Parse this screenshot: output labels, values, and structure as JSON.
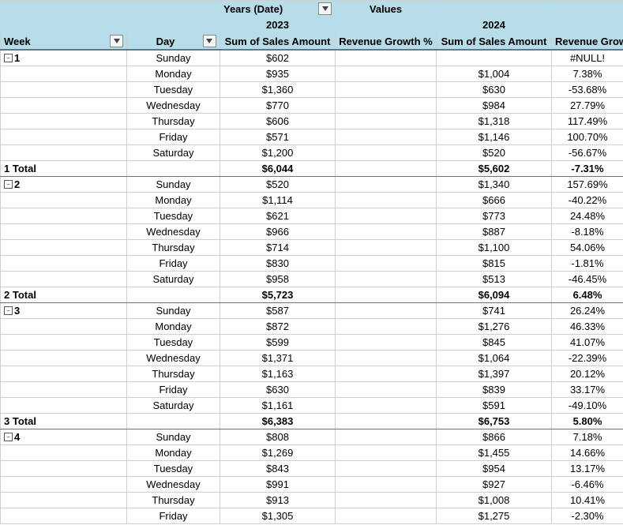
{
  "header": {
    "years_label": "Years (Date)",
    "values_label": "Values",
    "year_2023": "2023",
    "year_2024": "2024",
    "week_label": "Week",
    "day_label": "Day",
    "sales_label": "Sum of Sales Amount",
    "growth_label": "Revenue Growth %"
  },
  "groups": [
    {
      "week": "1",
      "rows": [
        {
          "day": "Sunday",
          "sales2023": "$602",
          "growth2023": "",
          "sales2024": "",
          "growth2024": ""
        },
        {
          "day": "Monday",
          "sales2023": "$935",
          "growth2023": "",
          "sales2024": "$1,004",
          "growth2024": "7.38%"
        },
        {
          "day": "Tuesday",
          "sales2023": "$1,360",
          "growth2023": "",
          "sales2024": "$630",
          "growth2024": "-53.68%"
        },
        {
          "day": "Wednesday",
          "sales2023": "$770",
          "growth2023": "",
          "sales2024": "$984",
          "growth2024": "27.79%"
        },
        {
          "day": "Thursday",
          "sales2023": "$606",
          "growth2023": "",
          "sales2024": "$1,318",
          "growth2024": "117.49%"
        },
        {
          "day": "Friday",
          "sales2023": "$571",
          "growth2023": "",
          "sales2024": "$1,146",
          "growth2024": "100.70%"
        },
        {
          "day": "Saturday",
          "sales2023": "$1,200",
          "growth2023": "",
          "sales2024": "$520",
          "growth2024": "-56.67%"
        }
      ],
      "total": {
        "label": "1 Total",
        "sales2023": "$6,044",
        "growth2023": "",
        "sales2024": "$5,602",
        "growth2024": "-7.31%"
      },
      "first_row_growth_2024": "#NULL!"
    },
    {
      "week": "2",
      "rows": [
        {
          "day": "Sunday",
          "sales2023": "$520",
          "growth2023": "",
          "sales2024": "$1,340",
          "growth2024": "157.69%"
        },
        {
          "day": "Monday",
          "sales2023": "$1,114",
          "growth2023": "",
          "sales2024": "$666",
          "growth2024": "-40.22%"
        },
        {
          "day": "Tuesday",
          "sales2023": "$621",
          "growth2023": "",
          "sales2024": "$773",
          "growth2024": "24.48%"
        },
        {
          "day": "Wednesday",
          "sales2023": "$966",
          "growth2023": "",
          "sales2024": "$887",
          "growth2024": "-8.18%"
        },
        {
          "day": "Thursday",
          "sales2023": "$714",
          "growth2023": "",
          "sales2024": "$1,100",
          "growth2024": "54.06%"
        },
        {
          "day": "Friday",
          "sales2023": "$830",
          "growth2023": "",
          "sales2024": "$815",
          "growth2024": "-1.81%"
        },
        {
          "day": "Saturday",
          "sales2023": "$958",
          "growth2023": "",
          "sales2024": "$513",
          "growth2024": "-46.45%"
        }
      ],
      "total": {
        "label": "2 Total",
        "sales2023": "$5,723",
        "growth2023": "",
        "sales2024": "$6,094",
        "growth2024": "6.48%"
      }
    },
    {
      "week": "3",
      "rows": [
        {
          "day": "Sunday",
          "sales2023": "$587",
          "growth2023": "",
          "sales2024": "$741",
          "growth2024": "26.24%"
        },
        {
          "day": "Monday",
          "sales2023": "$872",
          "growth2023": "",
          "sales2024": "$1,276",
          "growth2024": "46.33%"
        },
        {
          "day": "Tuesday",
          "sales2023": "$599",
          "growth2023": "",
          "sales2024": "$845",
          "growth2024": "41.07%"
        },
        {
          "day": "Wednesday",
          "sales2023": "$1,371",
          "growth2023": "",
          "sales2024": "$1,064",
          "growth2024": "-22.39%"
        },
        {
          "day": "Thursday",
          "sales2023": "$1,163",
          "growth2023": "",
          "sales2024": "$1,397",
          "growth2024": "20.12%"
        },
        {
          "day": "Friday",
          "sales2023": "$630",
          "growth2023": "",
          "sales2024": "$839",
          "growth2024": "33.17%"
        },
        {
          "day": "Saturday",
          "sales2023": "$1,161",
          "growth2023": "",
          "sales2024": "$591",
          "growth2024": "-49.10%"
        }
      ],
      "total": {
        "label": "3 Total",
        "sales2023": "$6,383",
        "growth2023": "",
        "sales2024": "$6,753",
        "growth2024": "5.80%"
      }
    },
    {
      "week": "4",
      "rows": [
        {
          "day": "Sunday",
          "sales2023": "$808",
          "growth2023": "",
          "sales2024": "$866",
          "growth2024": "7.18%"
        },
        {
          "day": "Monday",
          "sales2023": "$1,269",
          "growth2023": "",
          "sales2024": "$1,455",
          "growth2024": "14.66%"
        },
        {
          "day": "Tuesday",
          "sales2023": "$843",
          "growth2023": "",
          "sales2024": "$954",
          "growth2024": "13.17%"
        },
        {
          "day": "Wednesday",
          "sales2023": "$991",
          "growth2023": "",
          "sales2024": "$927",
          "growth2024": "-6.46%"
        },
        {
          "day": "Thursday",
          "sales2023": "$913",
          "growth2023": "",
          "sales2024": "$1,008",
          "growth2024": "10.41%"
        },
        {
          "day": "Friday",
          "sales2023": "$1,305",
          "growth2023": "",
          "sales2024": "$1,275",
          "growth2024": "-2.30%"
        }
      ]
    }
  ]
}
